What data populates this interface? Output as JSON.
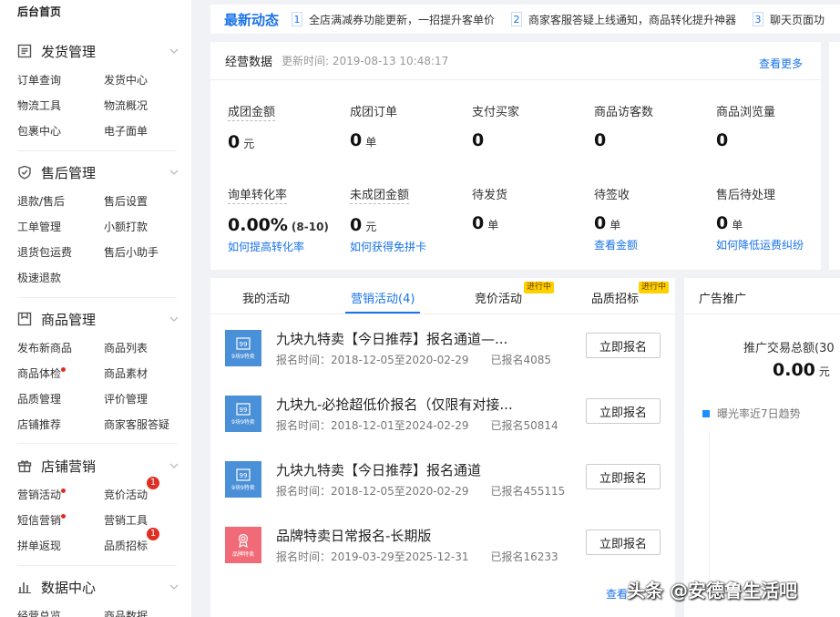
{
  "sidebar": {
    "home": "后台首页",
    "sections": [
      {
        "title": "发货管理",
        "icon": "list-icon",
        "items": [
          "订单查询",
          "发货中心",
          "物流工具",
          "物流概况",
          "包裹中心",
          "电子面单"
        ]
      },
      {
        "title": "售后管理",
        "icon": "shield-icon",
        "items": [
          "退款/售后",
          "售后设置",
          "工单管理",
          "小额打款",
          "退货包运费",
          "售后小助手",
          "极速退款"
        ]
      },
      {
        "title": "商品管理",
        "icon": "box-icon",
        "items": [
          "发布新商品",
          "商品列表",
          "商品体检",
          "商品素材",
          "品质管理",
          "评价管理",
          "店铺推荐",
          "商家客服答疑"
        ]
      },
      {
        "title": "店铺营销",
        "icon": "gift-icon",
        "items": [
          "营销活动",
          "竞价活动",
          "短信营销",
          "营销工具",
          "拼单返现",
          "品质招标"
        ],
        "badge": "1"
      },
      {
        "title": "数据中心",
        "icon": "bar-chart-icon",
        "items": [
          "经营总览",
          "商品数据"
        ]
      }
    ]
  },
  "news": {
    "title": "最新动态",
    "items": [
      {
        "num": "1",
        "text": "全店满减券功能更新，一招提升客单价"
      },
      {
        "num": "2",
        "text": "商家客服答疑上线通知，商品转化提升神器"
      },
      {
        "num": "3",
        "text": "聊天页面功"
      }
    ]
  },
  "business": {
    "title": "经营数据",
    "updated": "更新时间: 2019-08-13 10:48:17",
    "more": "查看更多",
    "stats": [
      {
        "label": "成团金额",
        "value": "0",
        "unit": "元"
      },
      {
        "label": "成团订单",
        "value": "0",
        "unit": "单"
      },
      {
        "label": "支付买家",
        "value": "0",
        "unit": ""
      },
      {
        "label": "商品访客数",
        "value": "0",
        "unit": ""
      },
      {
        "label": "商品浏览量",
        "value": "0",
        "unit": ""
      },
      {
        "label": "询单转化率",
        "value": "0.00%",
        "unit": "(8-10)",
        "link": "如何提高转化率"
      },
      {
        "label": "未成团金额",
        "value": "0",
        "unit": "元",
        "link": "如何获得免拼卡"
      },
      {
        "label": "待发货",
        "value": "0",
        "unit": "单"
      },
      {
        "label": "待签收",
        "value": "0",
        "unit": "单",
        "link": "查看金额"
      },
      {
        "label": "售后待处理",
        "value": "0",
        "unit": "单",
        "link": "如何降低运费纠纷"
      }
    ]
  },
  "activities": {
    "tabs": [
      {
        "label": "我的活动"
      },
      {
        "label": "营销活动(4)"
      },
      {
        "label": "竞价活动",
        "tag": "进行中"
      },
      {
        "label": "品质招标",
        "tag": "进行中"
      }
    ],
    "rows": [
      {
        "title": "九块九特卖【今日推荐】报名通道—...",
        "time": "报名时间：2018-12-05至2020-02-29",
        "count": "已报名4085",
        "thumb": "9块9特卖",
        "color": "blue"
      },
      {
        "title": "九块九-必抢超低价报名（仅限有对接...",
        "time": "报名时间：2018-12-01至2024-02-29",
        "count": "已报名50814",
        "thumb": "9块9特卖",
        "color": "blue"
      },
      {
        "title": "九块九特卖【今日推荐】报名通道",
        "time": "报名时间：2018-12-05至2020-02-29",
        "count": "已报名455115",
        "thumb": "9块9特卖",
        "color": "blue"
      },
      {
        "title": "品牌特卖日常报名-长期版",
        "time": "报名时间：2019-03-29至2025-12-31",
        "count": "已报名16233",
        "thumb": "品牌特卖",
        "color": "pink"
      }
    ],
    "button": "立即报名",
    "more": "查看"
  },
  "ads": {
    "title": "广告推广",
    "total_label": "推广交易总额(30",
    "total_value": "0.00",
    "total_unit": "元",
    "legend": "曝光率近7日趋势"
  },
  "watermark": "头条 @安德鲁生活吧"
}
